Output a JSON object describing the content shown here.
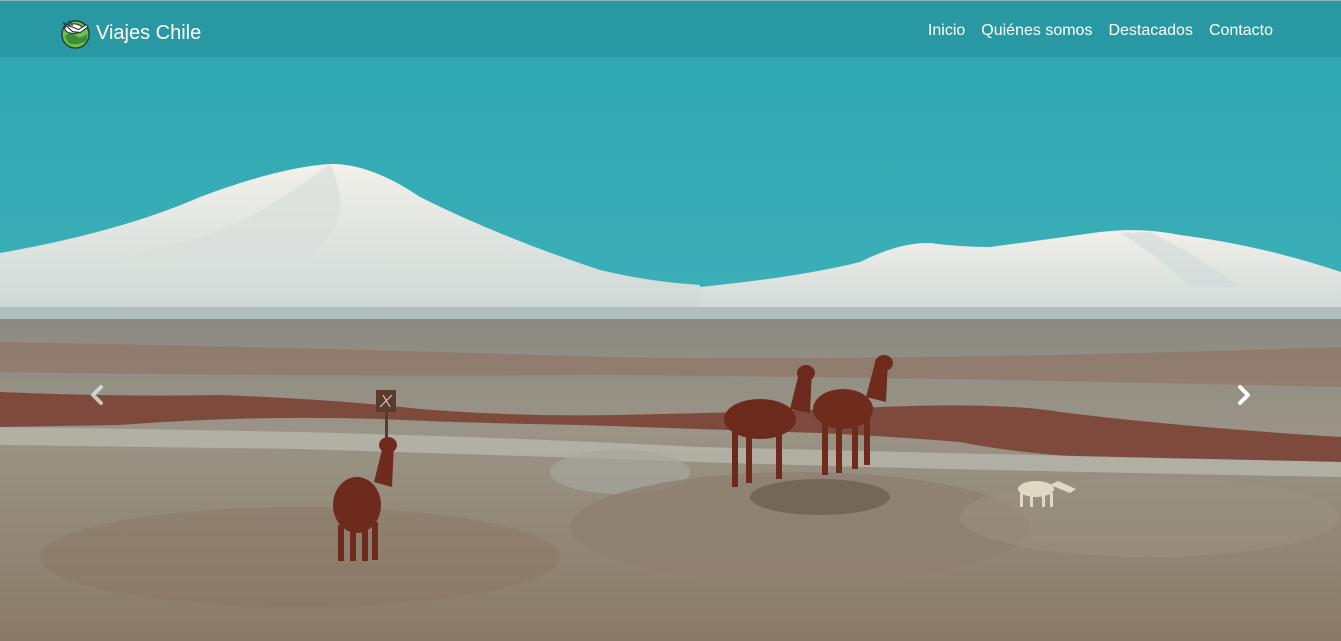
{
  "navbar": {
    "brand": {
      "text": "Viajes Chile",
      "logo_icon": "globe-plane-logo-icon"
    },
    "links": [
      {
        "label": "Inicio"
      },
      {
        "label": "Quiénes somos"
      },
      {
        "label": "Destacados"
      },
      {
        "label": "Contacto"
      }
    ]
  },
  "carousel": {
    "slide_image": "altiplano-llamas-volcano-photo",
    "prev_icon": "chevron-left-icon",
    "next_icon": "chevron-right-icon"
  },
  "colors": {
    "navbar_bg": "#2899a3",
    "sky": "#37abb4",
    "text": "#ffffff"
  }
}
